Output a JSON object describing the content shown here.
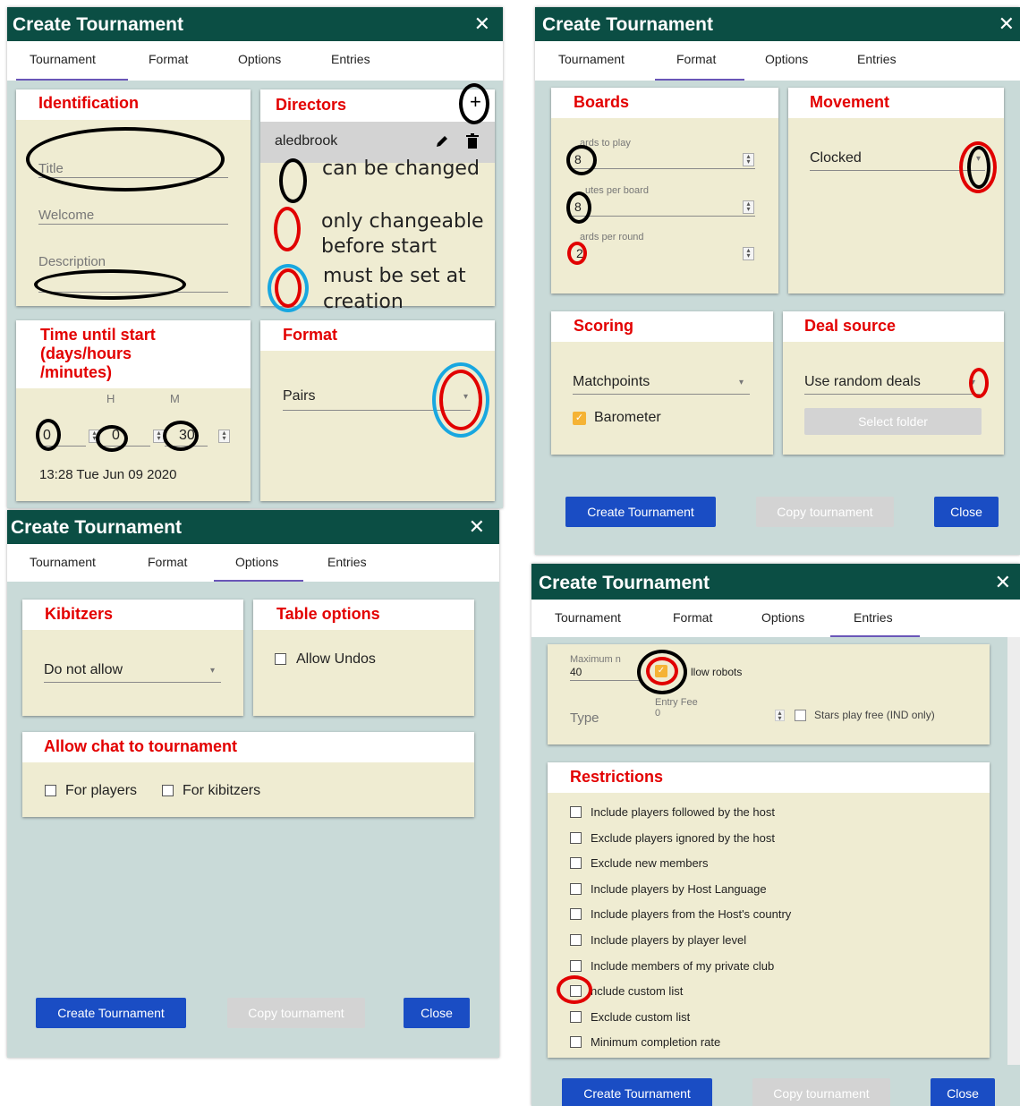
{
  "dialog_title": "Create Tournament",
  "close_glyph": "✕",
  "tabs": [
    "Tournament",
    "Format",
    "Options",
    "Entries"
  ],
  "tournament": {
    "identification": {
      "heading": "Identification",
      "title_placeholder": "Title",
      "welcome_placeholder": "Welcome",
      "description_placeholder": "Description"
    },
    "directors": {
      "heading": "Directors",
      "add_glyph": "+",
      "director_name": "aledbrook",
      "edit_icon": "pencil-icon",
      "delete_icon": "trash-icon"
    },
    "legend": {
      "changed": "can be changed",
      "before_start_1": "only changeable",
      "before_start_2": "before start",
      "creation_1": "must be set at",
      "creation_2": "creation"
    },
    "time_until_start": {
      "heading_1": "Time until start",
      "heading_2": "(days/hours",
      "heading_3": "/minutes)",
      "hours_label": "H",
      "minutes_label": "M",
      "days": "0",
      "hours": "0",
      "minutes": "30",
      "start_time": "13:28 Tue Jun 09 2020"
    },
    "format": {
      "heading": "Format",
      "value": "Pairs"
    }
  },
  "format_tab": {
    "boards": {
      "heading": "Boards",
      "to_play_label": "ards to play",
      "to_play": "8",
      "minutes_label": "utes per board",
      "minutes": "8",
      "per_round_label": "ards per round",
      "per_round": "2"
    },
    "movement": {
      "heading": "Movement",
      "value": "Clocked"
    },
    "scoring": {
      "heading": "Scoring",
      "value": "Matchpoints",
      "barometer": "Barometer",
      "barometer_checked": true
    },
    "deal_source": {
      "heading": "Deal source",
      "value": "Use random deals",
      "select_folder": "Select folder"
    }
  },
  "options_tab": {
    "kibitzers": {
      "heading": "Kibitzers",
      "value": "Do not allow"
    },
    "table_options": {
      "heading": "Table options",
      "allow_undos": "Allow Undos"
    },
    "chat": {
      "heading": "Allow chat to tournament",
      "for_players": "For players",
      "for_kibitzers": "For kibitzers"
    }
  },
  "entries_tab": {
    "maximum_label": "Maximum n",
    "maximum": "40",
    "allow_robots": "llow robots",
    "entry_fee_label": "Entry Fee",
    "entry_fee": "0",
    "type_label": "Type",
    "stars_free": "Stars play free (IND only)",
    "restrictions_heading": "Restrictions",
    "restrictions": [
      "Include players followed by the host",
      "Exclude players ignored by the host",
      "Exclude new members",
      "Include players by Host Language",
      "Include players from the Host's country",
      "Include players by player level",
      "Include members of my private club",
      "nclude custom list",
      "Exclude custom list",
      "Minimum completion rate"
    ]
  },
  "buttons": {
    "create": "Create Tournament",
    "copy": "Copy tournament",
    "close": "Close"
  },
  "colors": {
    "title_bar": "#0b4e44",
    "heading_red": "#e30000",
    "button_blue": "#1a4dc4",
    "card_bg": "#efecd2",
    "dialog_bg": "#c9dad8"
  }
}
